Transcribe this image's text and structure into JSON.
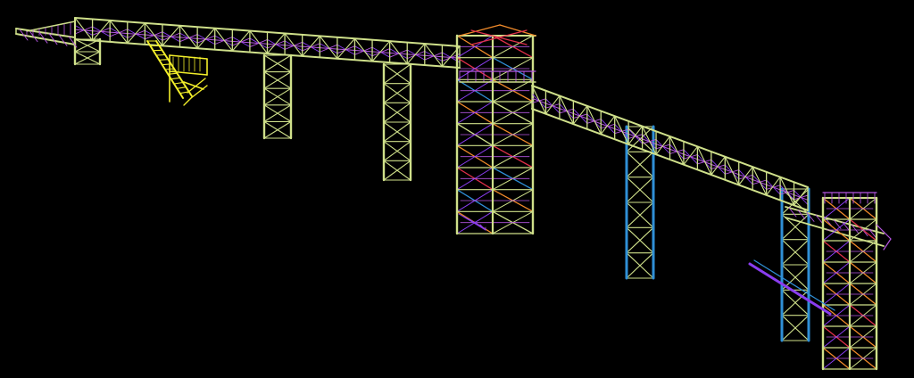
{
  "scene": {
    "background": "#000000",
    "colors": {
      "truss": "#cfe08a",
      "bracing": "#8a3df0",
      "handrail": "#b455e0",
      "stair": "#f2ee2a",
      "blue_column": "#2f8fd6",
      "orange_brace": "#f08a2a",
      "red_brace": "#e0304a",
      "cyan": "#3fd0e0"
    }
  }
}
